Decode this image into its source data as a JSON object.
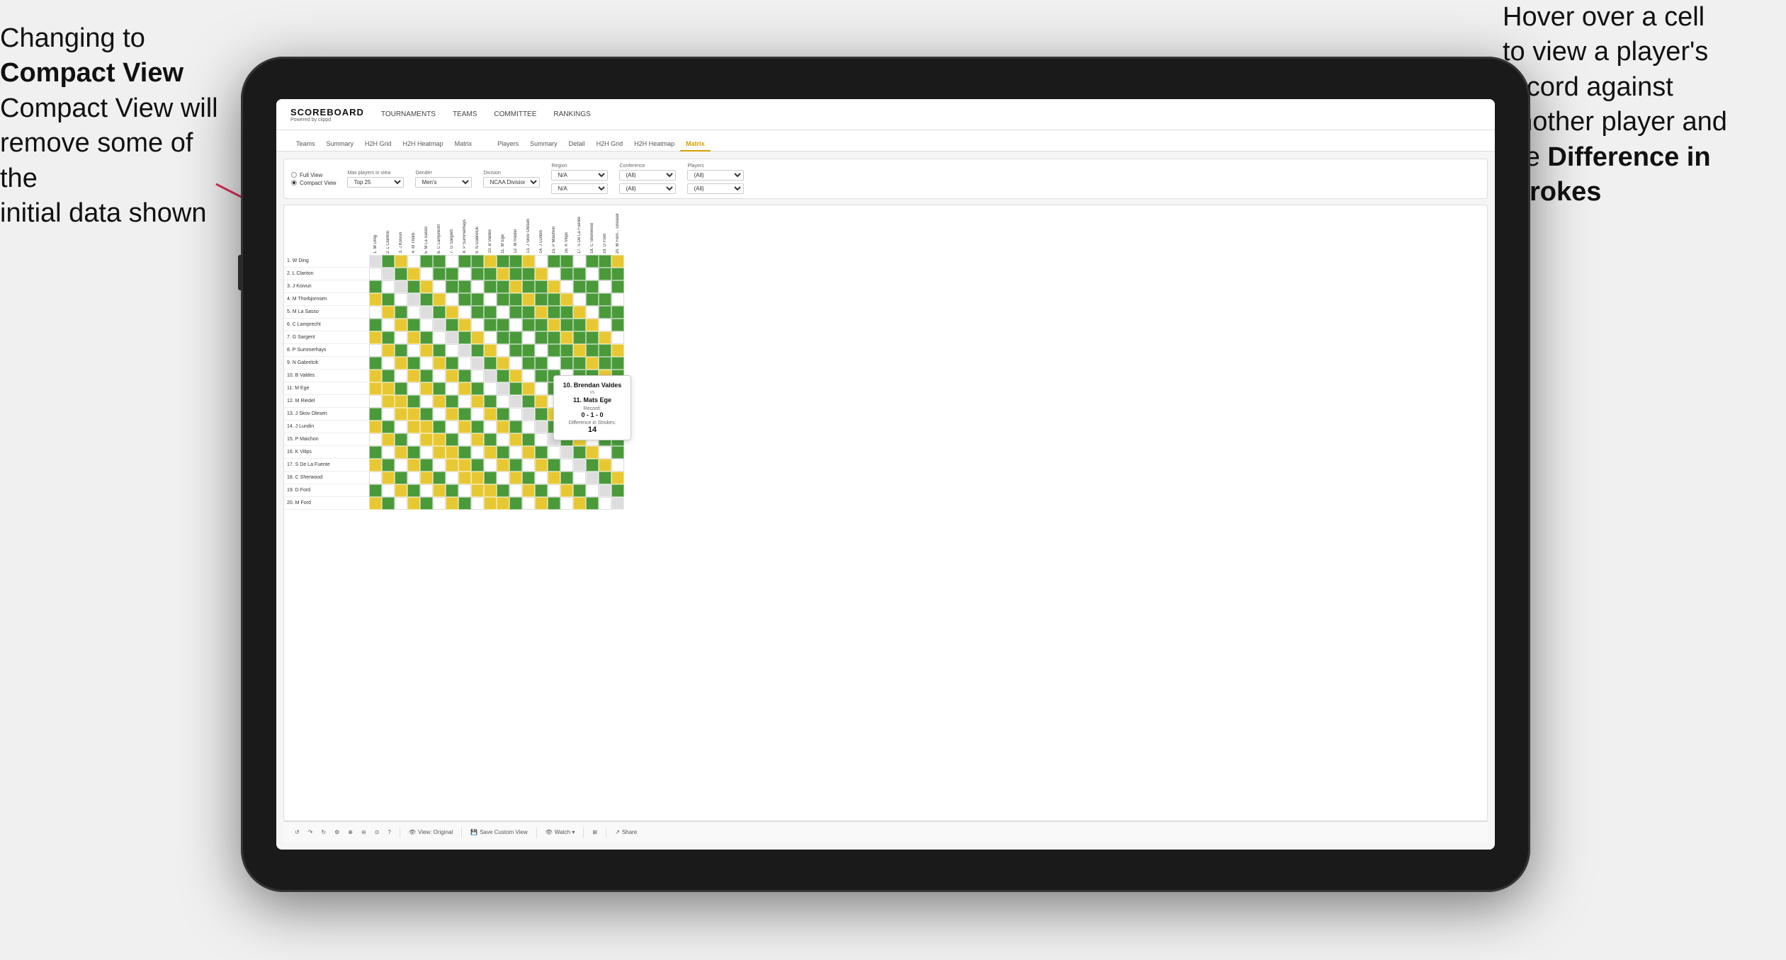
{
  "annotations": {
    "left": {
      "line1": "Changing to",
      "line2": "Compact View will",
      "line3": "remove some of the",
      "line4": "initial data shown"
    },
    "right": {
      "line1": "Hover over a cell",
      "line2": "to view a player's",
      "line3": "record against",
      "line4": "another player and",
      "line5": "the",
      "bold": "Difference in Strokes"
    }
  },
  "nav": {
    "logo": "SCOREBOARD",
    "logo_sub": "Powered by clippd",
    "items": [
      "TOURNAMENTS",
      "TEAMS",
      "COMMITTEE",
      "RANKINGS"
    ]
  },
  "sub_tabs": {
    "group1": [
      "Teams",
      "Summary",
      "H2H Grid",
      "H2H Heatmap",
      "Matrix"
    ],
    "group2": [
      "Players",
      "Summary",
      "Detail",
      "H2H Grid",
      "H2H Heatmap",
      "Matrix"
    ],
    "active": "Matrix"
  },
  "controls": {
    "view_options": {
      "label": "View",
      "full_view": "Full View",
      "compact_view": "Compact View",
      "selected": "compact"
    },
    "max_players": {
      "label": "Max players in view",
      "value": "Top 25"
    },
    "gender": {
      "label": "Gender",
      "value": "Men's"
    },
    "division": {
      "label": "Division",
      "value": "NCAA Division I"
    },
    "region": {
      "label": "Region",
      "options": [
        "N/A",
        "N/A"
      ]
    },
    "conference": {
      "label": "Conference",
      "options": [
        "(All)",
        "(All)"
      ]
    },
    "players": {
      "label": "Players",
      "options": [
        "(All)",
        "(All)"
      ]
    }
  },
  "players": [
    "1. W Ding",
    "2. L Clanton",
    "3. J Koivun",
    "4. M Thorbjornsen",
    "5. M La Sasso",
    "6. C Lamprecht",
    "7. G Sargent",
    "8. P Summerhays",
    "9. N Gabrelcik",
    "10. B Valdes",
    "11. M Ege",
    "12. M Riedel",
    "13. J Skov Olesen",
    "14. J Lundin",
    "15. P Maichon",
    "16. K Vilips",
    "17. S De La Fuente",
    "18. C Sherwood",
    "19. D Ford",
    "20. M Ford"
  ],
  "col_headers": [
    "1. W Ding",
    "2. L Clanton",
    "3. J Koivun",
    "4. M Thorb.",
    "5. M La Sasso",
    "6. C Lamprecht",
    "7. G Sargent",
    "8. P Summerhays",
    "9. N Gabrelcik",
    "10. B Valdes",
    "11. M Ege",
    "12. M Riedel",
    "13. J Skov Olesen",
    "14. J Lundin",
    "15. P Maichon",
    "16. K Vilips",
    "17. S De La Fuente",
    "18. C Sherwood",
    "19. D Ford",
    "20. M Fern... Greaser"
  ],
  "tooltip": {
    "player1": "10. Brendan Valdes",
    "vs": "vs",
    "player2": "11. Mats Ege",
    "record_label": "Record:",
    "record": "0 - 1 - 0",
    "diff_label": "Difference in Strokes:",
    "diff_val": "14"
  },
  "toolbar": {
    "undo": "↺",
    "redo": "↻",
    "view_original": "View: Original",
    "save_custom": "Save Custom View",
    "watch": "Watch ▾",
    "share": "Share"
  },
  "colors": {
    "green": "#4a9a3a",
    "yellow": "#e8c832",
    "gray": "#bbbbbb",
    "white": "#ffffff",
    "self": "#dddddd",
    "accent": "#d4a000"
  }
}
